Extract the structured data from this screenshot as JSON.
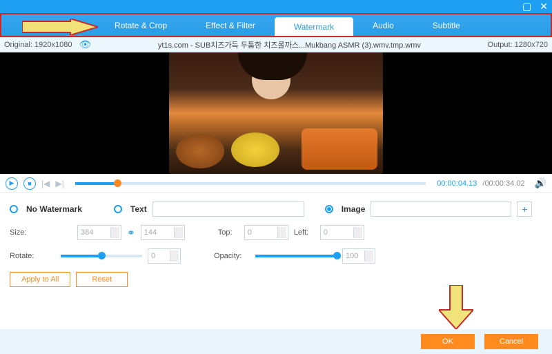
{
  "tabs": [
    "Rotate & Crop",
    "Effect & Filter",
    "Watermark",
    "Audio",
    "Subtitle"
  ],
  "active_tab_index": 2,
  "info": {
    "original_label": "Original:",
    "original_res": "1920x1080",
    "filename": "yt1s.com - SUB치즈가득 두툼한 치즈롤까스...Mukbang ASMR (3).wmv.tmp.wmv",
    "output_label": "Output:",
    "output_res": "1280x720"
  },
  "playback": {
    "current": "00:00:04.13",
    "total": "00:00:34.02",
    "progress_pct": 12
  },
  "wm": {
    "no_label": "No Watermark",
    "text_label": "Text",
    "image_label": "Image",
    "selected": "image",
    "text_value": "",
    "image_value": ""
  },
  "size": {
    "label": "Size:",
    "w": "384",
    "h": "144"
  },
  "pos": {
    "top_label": "Top:",
    "top": "0",
    "left_label": "Left:",
    "left": "0"
  },
  "rotate": {
    "label": "Rotate:",
    "value": "0",
    "pct": 50
  },
  "opacity": {
    "label": "Opacity:",
    "value": "100",
    "pct": 100
  },
  "buttons": {
    "apply_all": "Apply to All",
    "reset": "Reset",
    "ok": "OK",
    "cancel": "Cancel"
  }
}
